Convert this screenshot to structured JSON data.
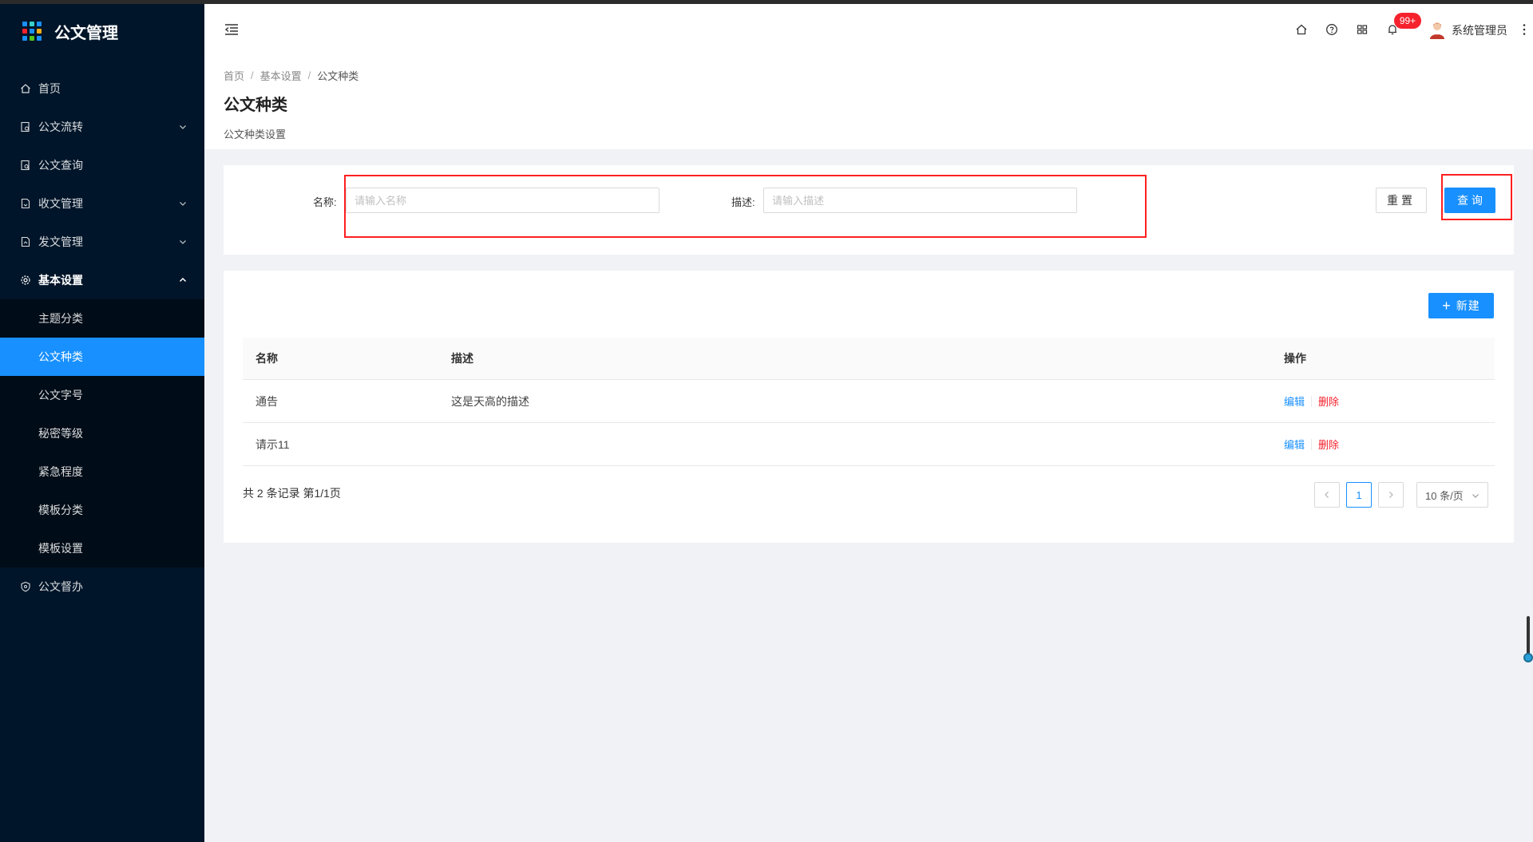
{
  "app": {
    "title": "公文管理"
  },
  "sidebar": {
    "items": [
      {
        "label": "首页",
        "icon": "home-icon"
      },
      {
        "label": "公文流转",
        "icon": "doc-flow-icon"
      },
      {
        "label": "公文查询",
        "icon": "doc-search-icon"
      },
      {
        "label": "收文管理",
        "icon": "inbox-doc-icon"
      },
      {
        "label": "发文管理",
        "icon": "send-doc-icon"
      },
      {
        "label": "基本设置",
        "icon": "gear-icon"
      },
      {
        "label": "公文督办",
        "icon": "shield-icon"
      }
    ],
    "submenu": [
      {
        "label": "主题分类"
      },
      {
        "label": "公文种类"
      },
      {
        "label": "公文字号"
      },
      {
        "label": "秘密等级"
      },
      {
        "label": "紧急程度"
      },
      {
        "label": "模板分类"
      },
      {
        "label": "模板设置"
      }
    ]
  },
  "header": {
    "notification_badge": "99+",
    "username": "系统管理员"
  },
  "breadcrumb": [
    "首页",
    "基本设置",
    "公文种类"
  ],
  "page": {
    "title": "公文种类",
    "subtitle": "公文种类设置"
  },
  "search": {
    "name_label": "名称:",
    "name_placeholder": "请输入名称",
    "desc_label": "描述:",
    "desc_placeholder": "请输入描述",
    "reset_label": "重置",
    "query_label": "查 询"
  },
  "table": {
    "new_label": "新建",
    "columns": [
      "名称",
      "描述",
      "操作"
    ],
    "rows": [
      {
        "name": "通告",
        "desc": "这是天高的描述",
        "edit": "编辑",
        "delete": "删除"
      },
      {
        "name": "请示11",
        "desc": "",
        "edit": "编辑",
        "delete": "删除"
      }
    ],
    "total_text": "共 2 条记录 第1/1页",
    "current_page": "1",
    "page_size": "10 条/页"
  },
  "colors": {
    "sidebar_bg": "#001529",
    "primary": "#1890ff",
    "danger": "#f5222d",
    "highlight_box": "#ff1f1f"
  }
}
